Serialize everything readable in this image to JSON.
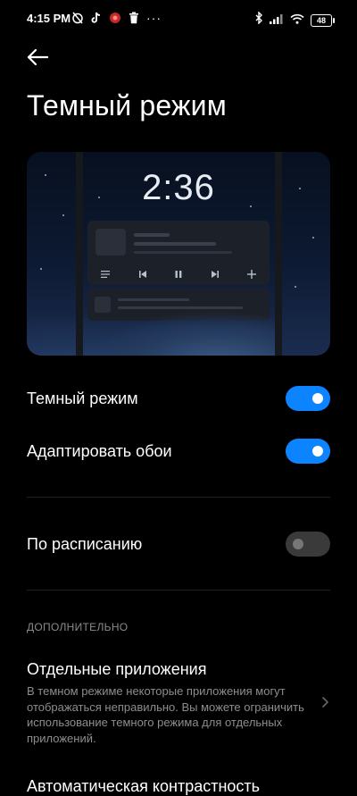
{
  "status_bar": {
    "time": "4:15 PM",
    "more": "···",
    "battery": "48",
    "icons": [
      "alarm-off-icon",
      "tiktok-icon",
      "notification-app-icon",
      "trash-icon",
      "bluetooth-icon",
      "signal-icon",
      "wifi-icon",
      "battery-icon"
    ]
  },
  "header": {
    "back_icon": "arrow-left-icon",
    "title": "Темный режим"
  },
  "preview": {
    "clock": "2:36",
    "accent_colors": {
      "sky_top": "#07101f",
      "sky_bottom": "#1b2c4f"
    }
  },
  "settings": {
    "dark_mode": {
      "label": "Темный режим",
      "enabled": true
    },
    "adapt_wallpaper": {
      "label": "Адаптировать обои",
      "enabled": true
    },
    "schedule": {
      "label": "По расписанию",
      "enabled": false
    }
  },
  "additional": {
    "header": "ДОПОЛНИТЕЛЬНО",
    "separate_apps": {
      "title": "Отдельные приложения",
      "description": "В темном режиме некоторые приложения могут отображаться неправильно. Вы можете ограничить использование темного режима для отдельных приложений."
    },
    "auto_contrast": {
      "title": "Автоматическая контрастность"
    }
  },
  "colors": {
    "toggle_on": "#0d84ff",
    "toggle_off": "#3a3a3a",
    "background": "#000000"
  }
}
